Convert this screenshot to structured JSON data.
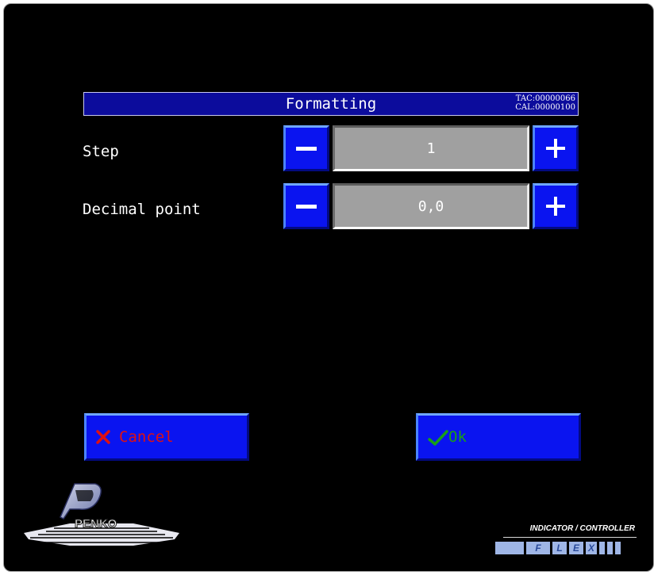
{
  "header": {
    "title": "Formatting",
    "tac": "TAC:00000066",
    "cal": "CAL:00000100"
  },
  "rows": [
    {
      "label": "Step",
      "value": "1"
    },
    {
      "label": "Decimal point",
      "value": "0,0"
    }
  ],
  "buttons": {
    "cancel_label": "Cancel",
    "ok_label": "Ok"
  },
  "brand": {
    "logo_text": "PENKO",
    "product_line": "INDICATOR / CONTROLLER",
    "product_letters": [
      "F",
      "L",
      "E",
      "X"
    ]
  },
  "colors": {
    "button_blue": "#0a14f0",
    "title_bar": "#0c0c9c",
    "cancel_text": "#e01010",
    "ok_text": "#18a018"
  }
}
